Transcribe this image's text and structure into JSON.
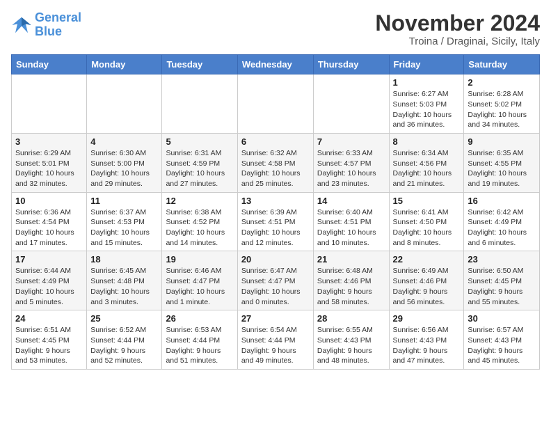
{
  "logo": {
    "line1": "General",
    "line2": "Blue"
  },
  "title": "November 2024",
  "location": "Troina / Draginai, Sicily, Italy",
  "days_of_week": [
    "Sunday",
    "Monday",
    "Tuesday",
    "Wednesday",
    "Thursday",
    "Friday",
    "Saturday"
  ],
  "weeks": [
    [
      {
        "day": "",
        "info": ""
      },
      {
        "day": "",
        "info": ""
      },
      {
        "day": "",
        "info": ""
      },
      {
        "day": "",
        "info": ""
      },
      {
        "day": "",
        "info": ""
      },
      {
        "day": "1",
        "info": "Sunrise: 6:27 AM\nSunset: 5:03 PM\nDaylight: 10 hours and 36 minutes."
      },
      {
        "day": "2",
        "info": "Sunrise: 6:28 AM\nSunset: 5:02 PM\nDaylight: 10 hours and 34 minutes."
      }
    ],
    [
      {
        "day": "3",
        "info": "Sunrise: 6:29 AM\nSunset: 5:01 PM\nDaylight: 10 hours and 32 minutes."
      },
      {
        "day": "4",
        "info": "Sunrise: 6:30 AM\nSunset: 5:00 PM\nDaylight: 10 hours and 29 minutes."
      },
      {
        "day": "5",
        "info": "Sunrise: 6:31 AM\nSunset: 4:59 PM\nDaylight: 10 hours and 27 minutes."
      },
      {
        "day": "6",
        "info": "Sunrise: 6:32 AM\nSunset: 4:58 PM\nDaylight: 10 hours and 25 minutes."
      },
      {
        "day": "7",
        "info": "Sunrise: 6:33 AM\nSunset: 4:57 PM\nDaylight: 10 hours and 23 minutes."
      },
      {
        "day": "8",
        "info": "Sunrise: 6:34 AM\nSunset: 4:56 PM\nDaylight: 10 hours and 21 minutes."
      },
      {
        "day": "9",
        "info": "Sunrise: 6:35 AM\nSunset: 4:55 PM\nDaylight: 10 hours and 19 minutes."
      }
    ],
    [
      {
        "day": "10",
        "info": "Sunrise: 6:36 AM\nSunset: 4:54 PM\nDaylight: 10 hours and 17 minutes."
      },
      {
        "day": "11",
        "info": "Sunrise: 6:37 AM\nSunset: 4:53 PM\nDaylight: 10 hours and 15 minutes."
      },
      {
        "day": "12",
        "info": "Sunrise: 6:38 AM\nSunset: 4:52 PM\nDaylight: 10 hours and 14 minutes."
      },
      {
        "day": "13",
        "info": "Sunrise: 6:39 AM\nSunset: 4:51 PM\nDaylight: 10 hours and 12 minutes."
      },
      {
        "day": "14",
        "info": "Sunrise: 6:40 AM\nSunset: 4:51 PM\nDaylight: 10 hours and 10 minutes."
      },
      {
        "day": "15",
        "info": "Sunrise: 6:41 AM\nSunset: 4:50 PM\nDaylight: 10 hours and 8 minutes."
      },
      {
        "day": "16",
        "info": "Sunrise: 6:42 AM\nSunset: 4:49 PM\nDaylight: 10 hours and 6 minutes."
      }
    ],
    [
      {
        "day": "17",
        "info": "Sunrise: 6:44 AM\nSunset: 4:49 PM\nDaylight: 10 hours and 5 minutes."
      },
      {
        "day": "18",
        "info": "Sunrise: 6:45 AM\nSunset: 4:48 PM\nDaylight: 10 hours and 3 minutes."
      },
      {
        "day": "19",
        "info": "Sunrise: 6:46 AM\nSunset: 4:47 PM\nDaylight: 10 hours and 1 minute."
      },
      {
        "day": "20",
        "info": "Sunrise: 6:47 AM\nSunset: 4:47 PM\nDaylight: 10 hours and 0 minutes."
      },
      {
        "day": "21",
        "info": "Sunrise: 6:48 AM\nSunset: 4:46 PM\nDaylight: 9 hours and 58 minutes."
      },
      {
        "day": "22",
        "info": "Sunrise: 6:49 AM\nSunset: 4:46 PM\nDaylight: 9 hours and 56 minutes."
      },
      {
        "day": "23",
        "info": "Sunrise: 6:50 AM\nSunset: 4:45 PM\nDaylight: 9 hours and 55 minutes."
      }
    ],
    [
      {
        "day": "24",
        "info": "Sunrise: 6:51 AM\nSunset: 4:45 PM\nDaylight: 9 hours and 53 minutes."
      },
      {
        "day": "25",
        "info": "Sunrise: 6:52 AM\nSunset: 4:44 PM\nDaylight: 9 hours and 52 minutes."
      },
      {
        "day": "26",
        "info": "Sunrise: 6:53 AM\nSunset: 4:44 PM\nDaylight: 9 hours and 51 minutes."
      },
      {
        "day": "27",
        "info": "Sunrise: 6:54 AM\nSunset: 4:44 PM\nDaylight: 9 hours and 49 minutes."
      },
      {
        "day": "28",
        "info": "Sunrise: 6:55 AM\nSunset: 4:43 PM\nDaylight: 9 hours and 48 minutes."
      },
      {
        "day": "29",
        "info": "Sunrise: 6:56 AM\nSunset: 4:43 PM\nDaylight: 9 hours and 47 minutes."
      },
      {
        "day": "30",
        "info": "Sunrise: 6:57 AM\nSunset: 4:43 PM\nDaylight: 9 hours and 45 minutes."
      }
    ]
  ]
}
